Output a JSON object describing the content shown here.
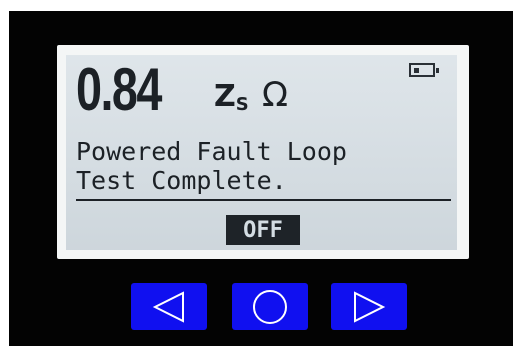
{
  "display": {
    "reading_value": "0.84",
    "reading_symbol": "Z",
    "reading_subscript": "S",
    "reading_unit": "Ω",
    "battery_level": 0.25,
    "message_line1": "Powered Fault Loop",
    "message_line2": "Test Complete.",
    "softkey_label": "OFF"
  },
  "buttons": {
    "left": {
      "icon": "triangle-left-icon"
    },
    "center": {
      "icon": "circle-icon"
    },
    "right": {
      "icon": "triangle-right-icon"
    }
  },
  "colors": {
    "device_body": "#030303",
    "lcd_background": "#d4dde3",
    "lcd_text": "#1c2126",
    "button_blue": "#1010f0"
  }
}
